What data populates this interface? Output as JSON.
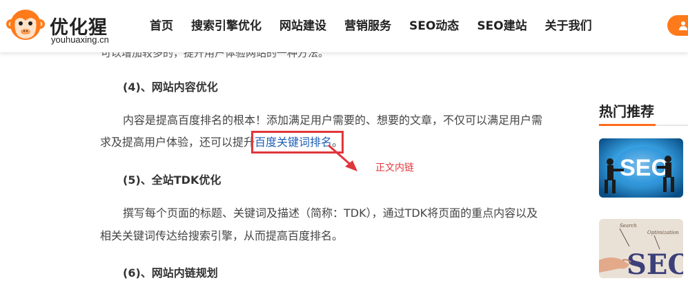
{
  "brand": {
    "name": "优化猩",
    "domain": "youhuaxing.cn"
  },
  "nav": [
    "首页",
    "搜索引擎优化",
    "网站建设",
    "营销服务",
    "SEO动态",
    "SEO建站",
    "关于我们"
  ],
  "icons": {
    "user": "user-icon",
    "logo": "monkey-logo-icon",
    "arrow": "red-arrow-icon"
  },
  "colors": {
    "accent": "#ff6a1a",
    "link": "#1f5fb5",
    "annotation": "#e0363b"
  },
  "article": {
    "cut_line": "可以增加较多的，提升用户体验网站的一种方法。",
    "h4": "(4)、网站内容优化",
    "p4_line1": "内容是提高百度排名的根本！添加满足用户需要的、想要的文章，不仅可以满足用户需",
    "p4_line2_prefix": "求及提高用户体验，还可以提升",
    "p4_link": "百度关键词排名",
    "p4_suffix": "。",
    "h5": "(5)、全站TDK优化",
    "p5_line1": "撰写每个页面的标题、关键词及描述（简称：TDK），通过TDK将页面的重点内容以及",
    "p5_line2": "相关关键词传达给搜索引擎，从而提高百度排名。",
    "h6": "(6)、网站内链规划"
  },
  "annotation": {
    "label": "正文内链"
  },
  "sidebar": {
    "title": "热门推荐",
    "thumb1_text": "SEO",
    "thumb2_text": "SEO",
    "thumb2_small1": "Search",
    "thumb2_small2": "Optimization"
  }
}
